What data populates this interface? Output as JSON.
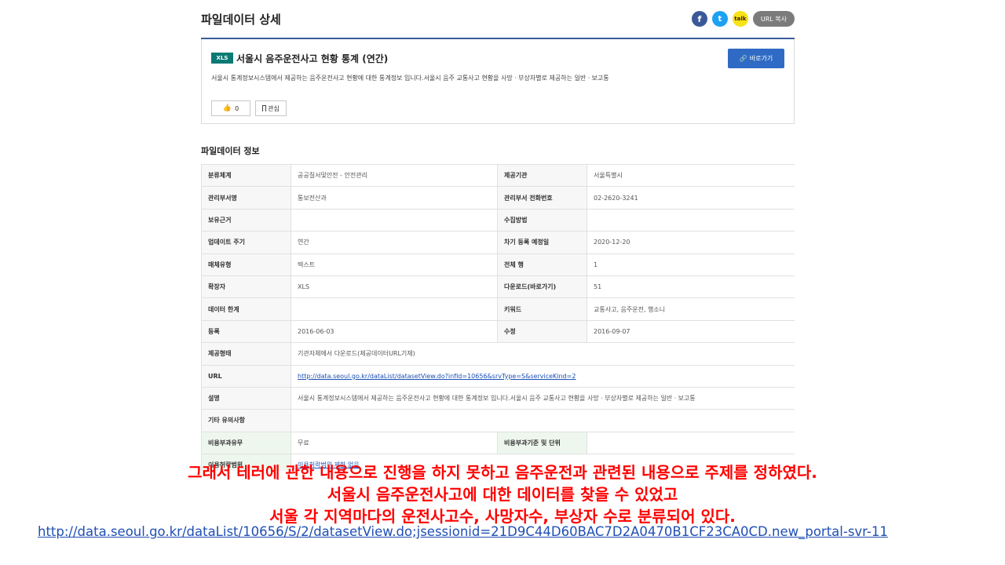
{
  "header": {
    "title": "파일데이터 상세",
    "share": {
      "facebook_glyph": "f",
      "twitter_glyph": "t",
      "kakao_glyph": "talk",
      "url_copy_label": "URL 복사"
    }
  },
  "dataset": {
    "badge": "XLS",
    "title": "서울시 음주운전사고 현황 통계 (연간)",
    "goto_label": "바로가기",
    "description": "서울시 통계정보시스템에서 제공하는 음주운전사고 현황에 대한 통계정보 입니다.서울시 음주 교통사고 현황을 사망ㆍ부상자별로 제공하는 일반ㆍ보고통",
    "like_count": "0",
    "fav_label": "관심"
  },
  "info": {
    "section_title": "파일데이터 정보",
    "rows": [
      [
        "분류체계",
        "공공질서및안전 - 안전관리",
        "제공기관",
        "서울특별시"
      ],
      [
        "관리부서명",
        "통보전산과",
        "관리부서 전화번호",
        "02-2620-3241"
      ],
      [
        "보유근거",
        "",
        "수집방법",
        ""
      ],
      [
        "업데이트 주기",
        "연간",
        "차기 등록 예정일",
        "2020-12-20"
      ],
      [
        "매체유형",
        "텍스트",
        "전체 행",
        "1"
      ],
      [
        "확장자",
        "XLS",
        "다운로드(바로가기)",
        "51"
      ],
      [
        "데이터 한계",
        "",
        "키워드",
        "교통사고, 음주운전, 행소니"
      ],
      [
        "등록",
        "2016-06-03",
        "수정",
        "2016-09-07"
      ],
      [
        "제공형태",
        "기관자체에서 다운로드(제공데이터URL기재)"
      ],
      [
        "URL",
        "http://data.seoul.go.kr/dataList/datasetView.do?infId=10656&srvType=S&serviceKind=2"
      ],
      [
        "설명",
        "서울시 통계정보시스템에서 제공하는 음주운전사고 현황에 대한 통계정보 입니다.서울시 음주 교통사고 현황을 사망ㆍ부상자별로 제공하는 일반ㆍ보고통"
      ],
      [
        "기타 유의사항",
        ""
      ],
      [
        "비용부과유무",
        "무료",
        "비용부과기준 및 단위",
        ""
      ],
      [
        "이용허락범위",
        "이용허락범위 제한 없음"
      ]
    ]
  },
  "caption": {
    "line1": "그래서 테러에 관한 내용으로 진행을 하지 못하고 음주운전과 관련된 내용으로 주제를 정하였다.",
    "line2": "서울시 음주운전사고에 대한 데이터를 찾을 수 있었고",
    "line3": "서울 각 지역마다의 운전사고수, 사망자수, 부상자 수로 분류되어 있다."
  },
  "link": "http://data.seoul.go.kr/dataList/10656/S/2/datasetView.do;jsessionid=21D9C44D60BAC7D2A0470B1CF23CA0CD.new_portal-svr-11",
  "colors": {
    "brand_blue": "#2f6bc4",
    "title_rule": "#3d5a9a",
    "badge_green": "#0b7a74",
    "caption_red": "#ff0000"
  },
  "icons": [
    "facebook-icon",
    "twitter-icon",
    "kakaotalk-icon",
    "link-icon",
    "thumbs-up-icon",
    "bookmark-icon"
  ]
}
